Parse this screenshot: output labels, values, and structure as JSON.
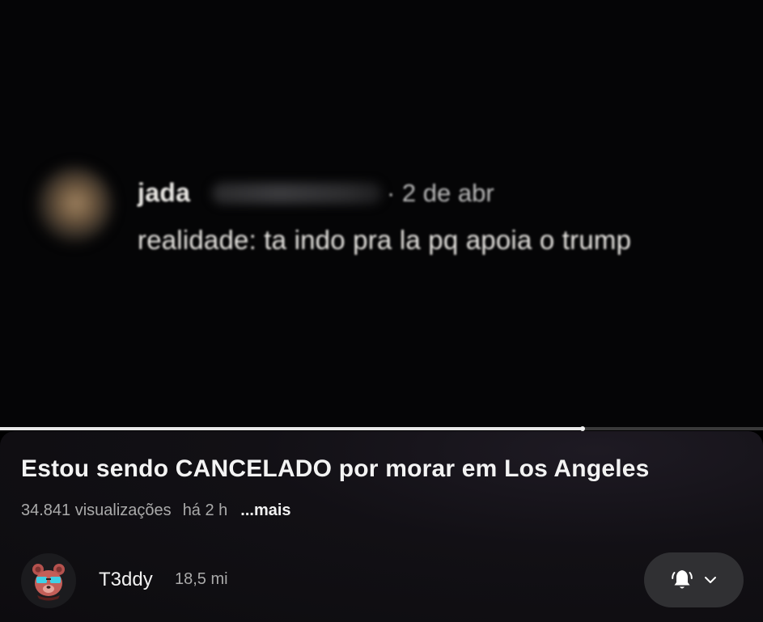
{
  "video_frame": {
    "comment": {
      "author": "jada",
      "date": "· 2 de abr",
      "text": "realidade: ta indo pra la pq apoia o trump"
    }
  },
  "progress": {
    "fraction": 0.764
  },
  "video_info": {
    "title": "Estou sendo CANCELADO por morar em Los Angeles",
    "views": "34.841 visualizações",
    "age": "há 2 h",
    "more_label": "...mais"
  },
  "channel": {
    "name": "T3ddy",
    "subscribers": "18,5 mi",
    "avatar_icon": "bear-icon"
  },
  "notify": {
    "icon": "bell-icon",
    "dropdown_icon": "chevron-down-icon"
  },
  "colors": {
    "background": "#000000",
    "panel": "#121015",
    "button": "#303033",
    "text_primary": "#f1f1f1",
    "text_secondary": "#aaaaaa"
  }
}
